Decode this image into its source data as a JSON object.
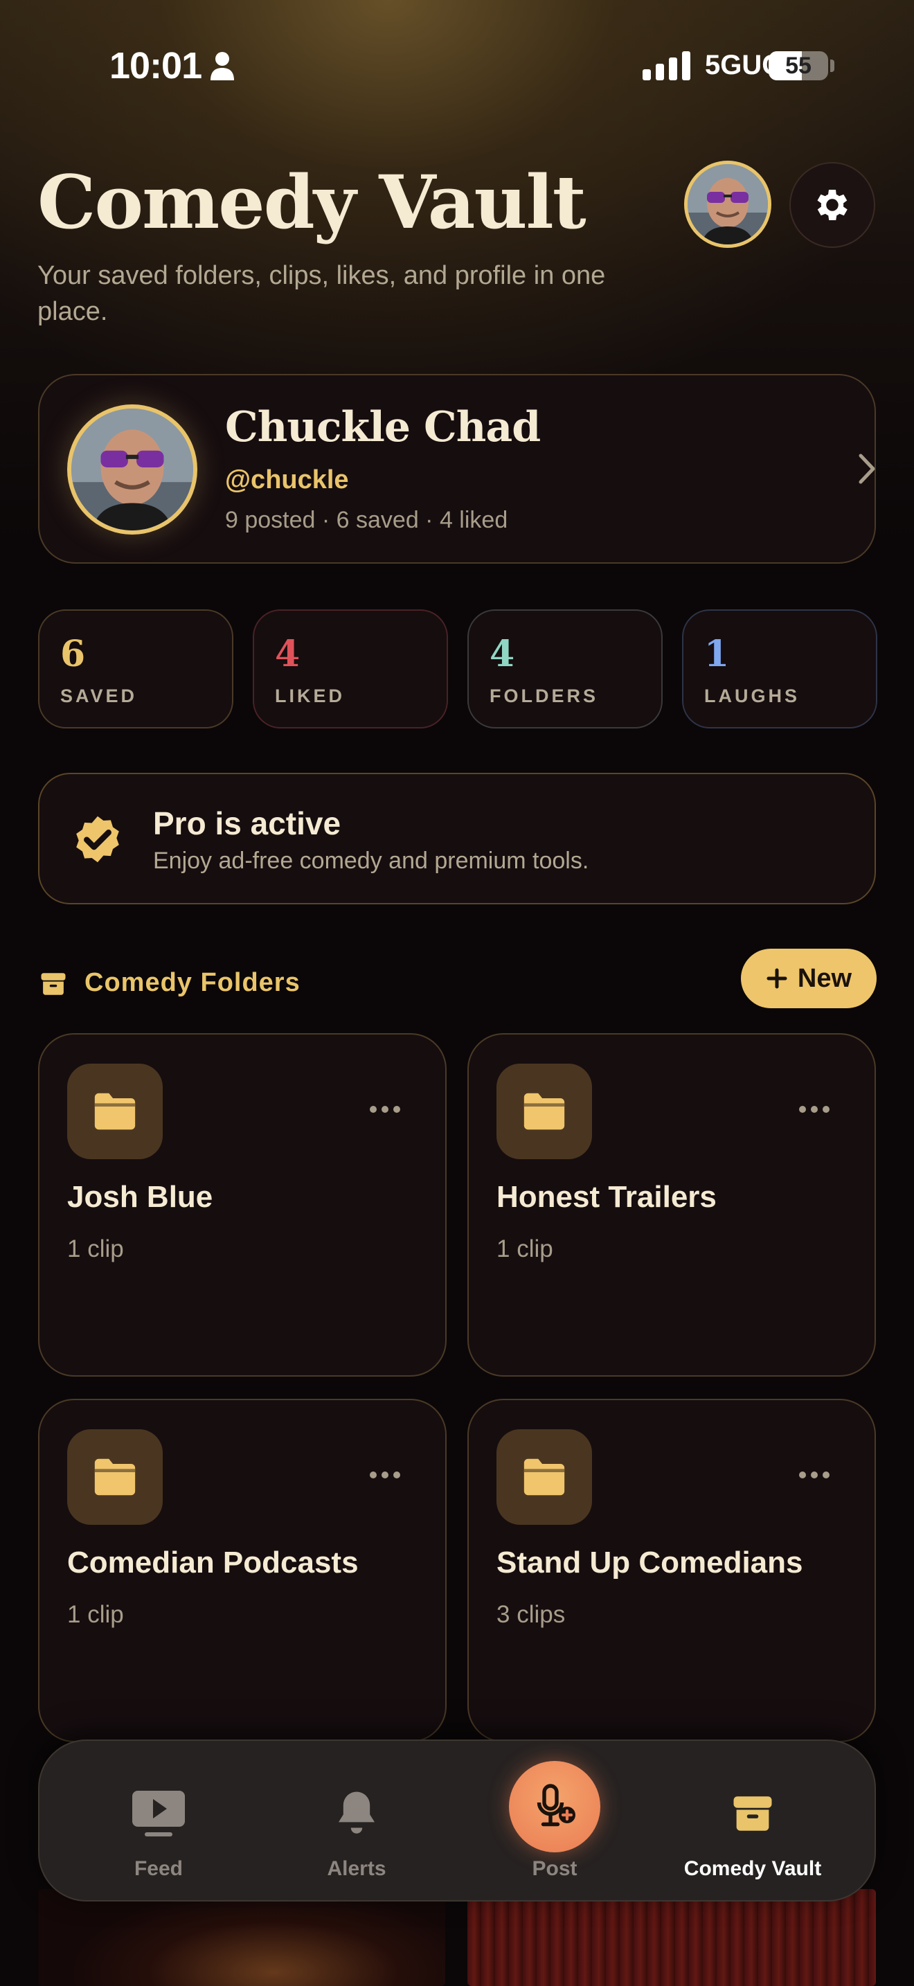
{
  "status_bar": {
    "time": "10:01",
    "network": "5GUC",
    "battery": "55"
  },
  "header": {
    "title": "Comedy Vault",
    "subtitle": "Your saved folders, clips, likes, and profile in one place."
  },
  "profile": {
    "name": "Chuckle Chad",
    "handle": "@chuckle",
    "stats": "9 posted · 6 saved · 4 liked"
  },
  "stats": [
    {
      "value": "6",
      "label": "SAVED",
      "color": "#e9c46a",
      "border": "#4a3a26"
    },
    {
      "value": "4",
      "label": "LIKED",
      "color": "#e0525a",
      "border": "#4a2226"
    },
    {
      "value": "4",
      "label": "FOLDERS",
      "color": "#8fd6c3",
      "border": "#3a3a3a"
    },
    {
      "value": "1",
      "label": "LAUGHS",
      "color": "#7fa8ee",
      "border": "#2e3448"
    }
  ],
  "pro": {
    "title": "Pro is active",
    "subtitle": "Enjoy ad-free comedy and premium tools."
  },
  "folders_section": {
    "title": "Comedy Folders",
    "new_label": "New"
  },
  "folders": [
    {
      "name": "Josh Blue",
      "count": "1 clip"
    },
    {
      "name": "Honest Trailers",
      "count": "1 clip"
    },
    {
      "name": "Comedian Podcasts",
      "count": "1 clip"
    },
    {
      "name": "Stand Up Comedians",
      "count": "3 clips"
    }
  ],
  "tabs": [
    {
      "label": "Feed",
      "icon": "play-icon"
    },
    {
      "label": "Alerts",
      "icon": "bell-icon"
    },
    {
      "label": "Post",
      "icon": "mic-add-icon"
    },
    {
      "label": "Comedy Vault",
      "icon": "archive-icon",
      "active": true
    }
  ],
  "colors": {
    "accent": "#e9c46a",
    "post_button": "#ea7c52",
    "background": "#0b0708"
  }
}
